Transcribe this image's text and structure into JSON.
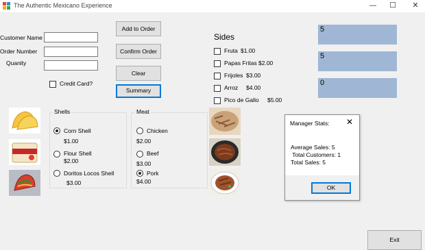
{
  "window": {
    "title": "The Authentic Mexicano Experience",
    "minimize_glyph": "—",
    "maximize_glyph": "☐",
    "close_glyph": "✕"
  },
  "form": {
    "customer_name_label": "Customer Name",
    "order_number_label": "Order Number",
    "quantity_label": "Quanity",
    "customer_name_value": "",
    "order_number_value": "",
    "quantity_value": "",
    "credit_card_label": "Credit Card?"
  },
  "buttons": {
    "add_to_order": "Add to Order",
    "confirm_order": "Confirm Order",
    "clear": "Clear",
    "summary": "Summary",
    "exit": "Exit"
  },
  "sides": {
    "heading": "Sides",
    "items": [
      {
        "name": "Fruta",
        "price": "$1.00"
      },
      {
        "name": "Papas Fritas",
        "price": "$2.00"
      },
      {
        "name": "Frijoles",
        "price": "$3.00"
      },
      {
        "name": "Arroz",
        "price": "$4.00"
      },
      {
        "name": "Pico de Gallo",
        "price": "$5.00"
      }
    ]
  },
  "outputs": [
    "5",
    "5",
    "0"
  ],
  "shells": {
    "title": "Shells",
    "options": [
      {
        "name": "Corn Shell",
        "price": "$1.00",
        "selected": true
      },
      {
        "name": "Flour Shell",
        "price": "$2.00",
        "selected": false
      },
      {
        "name": "Doritos Locos Shell",
        "price": "$3.00",
        "selected": false
      }
    ]
  },
  "meat": {
    "title": "Meat",
    "options": [
      {
        "name": "Chicken",
        "price": "$2.00",
        "selected": false
      },
      {
        "name": "Beef",
        "price": "$3.00",
        "selected": false
      },
      {
        "name": "Pork",
        "price": "$4.00",
        "selected": true
      }
    ]
  },
  "dialog": {
    "title": "Manager Stats:",
    "lines": [
      "Average Sales: 5",
      " Total Customers: 1",
      "Total Sales: 5"
    ],
    "ok": "OK"
  },
  "colors": {
    "output_bg": "#9fb7d4",
    "focus_border": "#0078d7"
  }
}
